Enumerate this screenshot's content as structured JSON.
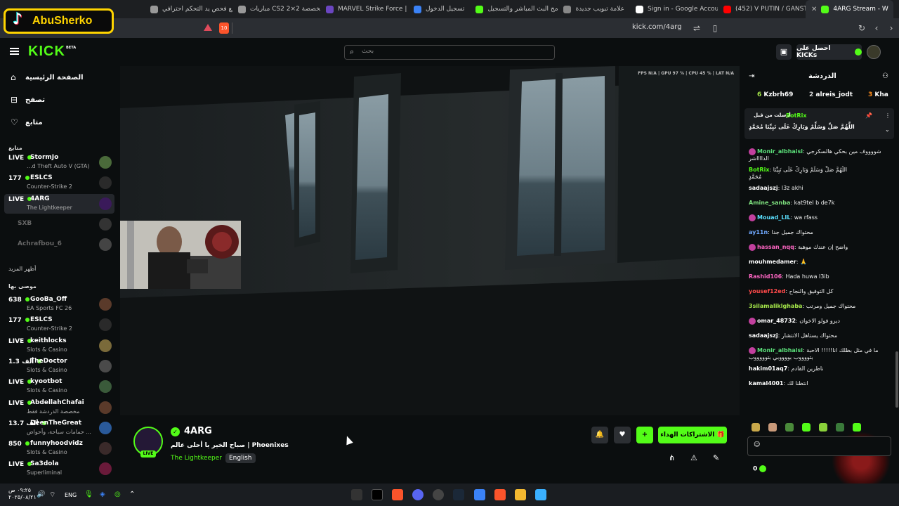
{
  "browser": {
    "tabs": [
      {
        "label": "4ARG Stream - W",
        "active": true,
        "color": "#53fc18"
      },
      {
        "label": "(452) V PUTIN / GANSTA",
        "color": "#ff0000"
      },
      {
        "label": "Sign in - Google Accounts",
        "color": "#ffffff"
      },
      {
        "label": "علامة تبويب جديدة",
        "color": "#888888"
      },
      {
        "label": "برنامج البث المباشر والتسجيل",
        "color": "#53fc18"
      },
      {
        "label": "تسجيل الدخول",
        "color": "#3b82f6"
      },
      {
        "label": "MARVEL Strike Force | Se",
        "color": "#6b46c1"
      },
      {
        "label": "مباريات CS2 المخصصة 2×2",
        "color": "#999999"
      },
      {
        "label": "موقع فحص يد التحكم احترافي",
        "color": "#999999"
      }
    ],
    "url": "kick.com/4arg",
    "brave_count": "10"
  },
  "overlay_badge": {
    "name": "AbuSherko"
  },
  "header": {
    "logo": "KICK",
    "beta": "BETA",
    "search_placeholder": "بحث",
    "get_kicks": "احصل على KICKs"
  },
  "sidebar": {
    "nav": [
      {
        "label": "الصفحة الرئيسية",
        "icon": "home-icon",
        "glyph": "⌂"
      },
      {
        "label": "تصفح",
        "icon": "browse-icon",
        "glyph": "⊟"
      },
      {
        "label": "متابع",
        "icon": "heart-icon",
        "glyph": "♡"
      }
    ],
    "following_title": "متابع",
    "following": [
      {
        "status": "LIVE",
        "name": "StormJo",
        "game": "...d Theft Auto V (GTA)",
        "color": "#4a6a3a"
      },
      {
        "status": "177",
        "name": "ESLCS",
        "game": "Counter-Strike 2",
        "color": "#2a2a2a"
      },
      {
        "status": "LIVE",
        "name": "4ARG",
        "game": "The Lightkeeper",
        "color": "#3a1a5a",
        "selected": true
      },
      {
        "offline": true,
        "name": "SXB",
        "color": "#333333"
      },
      {
        "offline": true,
        "name": "Achrafbou_6",
        "color": "#444444"
      }
    ],
    "show_more": "أظهر المزيد",
    "recommended_title": "موصى بها",
    "recommended": [
      {
        "status": "638",
        "name": "GooBa_Off",
        "game": "EA Sports FC 26",
        "color": "#5a3a2a"
      },
      {
        "status": "177",
        "name": "ESLCS",
        "game": "Counter-Strike 2",
        "color": "#2a2a2a"
      },
      {
        "status": "LIVE",
        "name": "keithlocks",
        "game": "Slots & Casino",
        "color": "#7a6a3a"
      },
      {
        "status": "1.3 ألف",
        "name": "TheDoctor",
        "game": "Slots & Casino",
        "color": "#4a4a4a"
      },
      {
        "status": "LIVE",
        "name": "kyootbot",
        "game": "Slots & Casino",
        "color": "#3a5a3a"
      },
      {
        "status": "LIVE",
        "name": "AbdellahChafai",
        "game": "مخصصة الدردشة فقط",
        "color": "#5a3a2a"
      },
      {
        "status": "13.7 ألف",
        "name": "DeenTheGreat",
        "game": "حمامات سباحة، وأحواض ...",
        "color": "#2a5a9a"
      },
      {
        "status": "850",
        "name": "funnyhoodvidz",
        "game": "Slots & Casino",
        "color": "#3a2a2a"
      },
      {
        "status": "LIVE",
        "name": "Sa3dola",
        "game": "Superliminal",
        "color": "#6a1a3a"
      }
    ]
  },
  "video": {
    "stats": "FPS N/A | GPU 97 % | CPU 45 % | LAT N/A"
  },
  "channel": {
    "name": "4ARG",
    "title": "صباح الخير يا أحلى عالم | Phoenixes",
    "category": "The Lightkeeper",
    "language": "English",
    "live": "LIVE",
    "subscribe_label": "الاشتراكات الهداء",
    "plus": "+"
  },
  "chat": {
    "title": "الدردشة",
    "gifters": [
      {
        "name": "Kha",
        "rank": "3",
        "color": "#ff8c1a"
      },
      {
        "name": "alreis_jodt",
        "rank": "2",
        "color": "#dddddd"
      },
      {
        "name": "Kzbrh69",
        "rank": "6",
        "color": "#a5e64a"
      }
    ],
    "pinned": {
      "sent_by": "أرسلت من قبل",
      "user": "BotRix",
      "message": "اللَّهُمَّ صَلِّ وَسَلِّمْ وَبَارِكْ عَلَى نَبِيِّنَا مُحَمَّدٍ"
    },
    "messages": [
      {
        "user": "Monir_albhaisi",
        "color": "#5be07a",
        "text": "شووووف مين بحكي هالسكرجي",
        "line2": "الدااااشر",
        "badge": true
      },
      {
        "user": "BotRix",
        "color": "#53fc18",
        "text": "اللَّهُمَّ صَلِّ وَسَلِّمْ وَبَارِكْ عَلَى نَبِيِّنَا",
        "line2": "مُحَمَّدٍ"
      },
      {
        "user": "sadaajszj",
        "color": "#ffffff",
        "text": "l3z akhi"
      },
      {
        "user": "Amine_sanba",
        "color": "#7ee07e",
        "text": "kat9tel b de7k"
      },
      {
        "user": "Mouad_LIL",
        "color": "#5be0ff",
        "text": "wa rfass",
        "badge": true
      },
      {
        "user": "ay11n",
        "color": "#6fa8ff",
        "text": "محتواك جميل جدا"
      },
      {
        "user": "hassan_nqq",
        "color": "#ff66c4",
        "text": "واضح إن عندك موهبة",
        "badge": true
      },
      {
        "user": "mouhmedamer",
        "color": "#ffffff",
        "text": "🙏"
      },
      {
        "user": "Rashid106",
        "color": "#ff66c4",
        "text": "Hada huwa l3ib"
      },
      {
        "user": "yousef12ed",
        "color": "#ff4a4a",
        "text": "كل التوفيق والنجاح"
      },
      {
        "user": "3silamaliklghaba",
        "color": "#a5e64a",
        "text": "محتواك جميل ومرتب"
      },
      {
        "user": "omar_48732",
        "color": "#ffffff",
        "text": "ديرو فولو الاخوان",
        "badge": true
      },
      {
        "user": "sadaajszj",
        "color": "#ffffff",
        "text": "محتواك يستاهل الانتشار"
      },
      {
        "user": "Monir_albhaisi",
        "color": "#5be07a",
        "text": "ما في مثل بظلك انا!!!!! الاحبة",
        "line2": "بتووووب بووووبي بتوووووب",
        "badge": true
      },
      {
        "user": "hakim01aq7",
        "color": "#ffffff",
        "text": "ناطرين القادم"
      },
      {
        "user": "kamal4001",
        "color": "#ffffff",
        "text": "انتظنا لك"
      }
    ],
    "kicks_balance": "0"
  },
  "taskbar": {
    "time": "٠٩:٢٥ ص",
    "date": "٢٠٢٥/٠٨/٢١",
    "lang": "ENG"
  }
}
